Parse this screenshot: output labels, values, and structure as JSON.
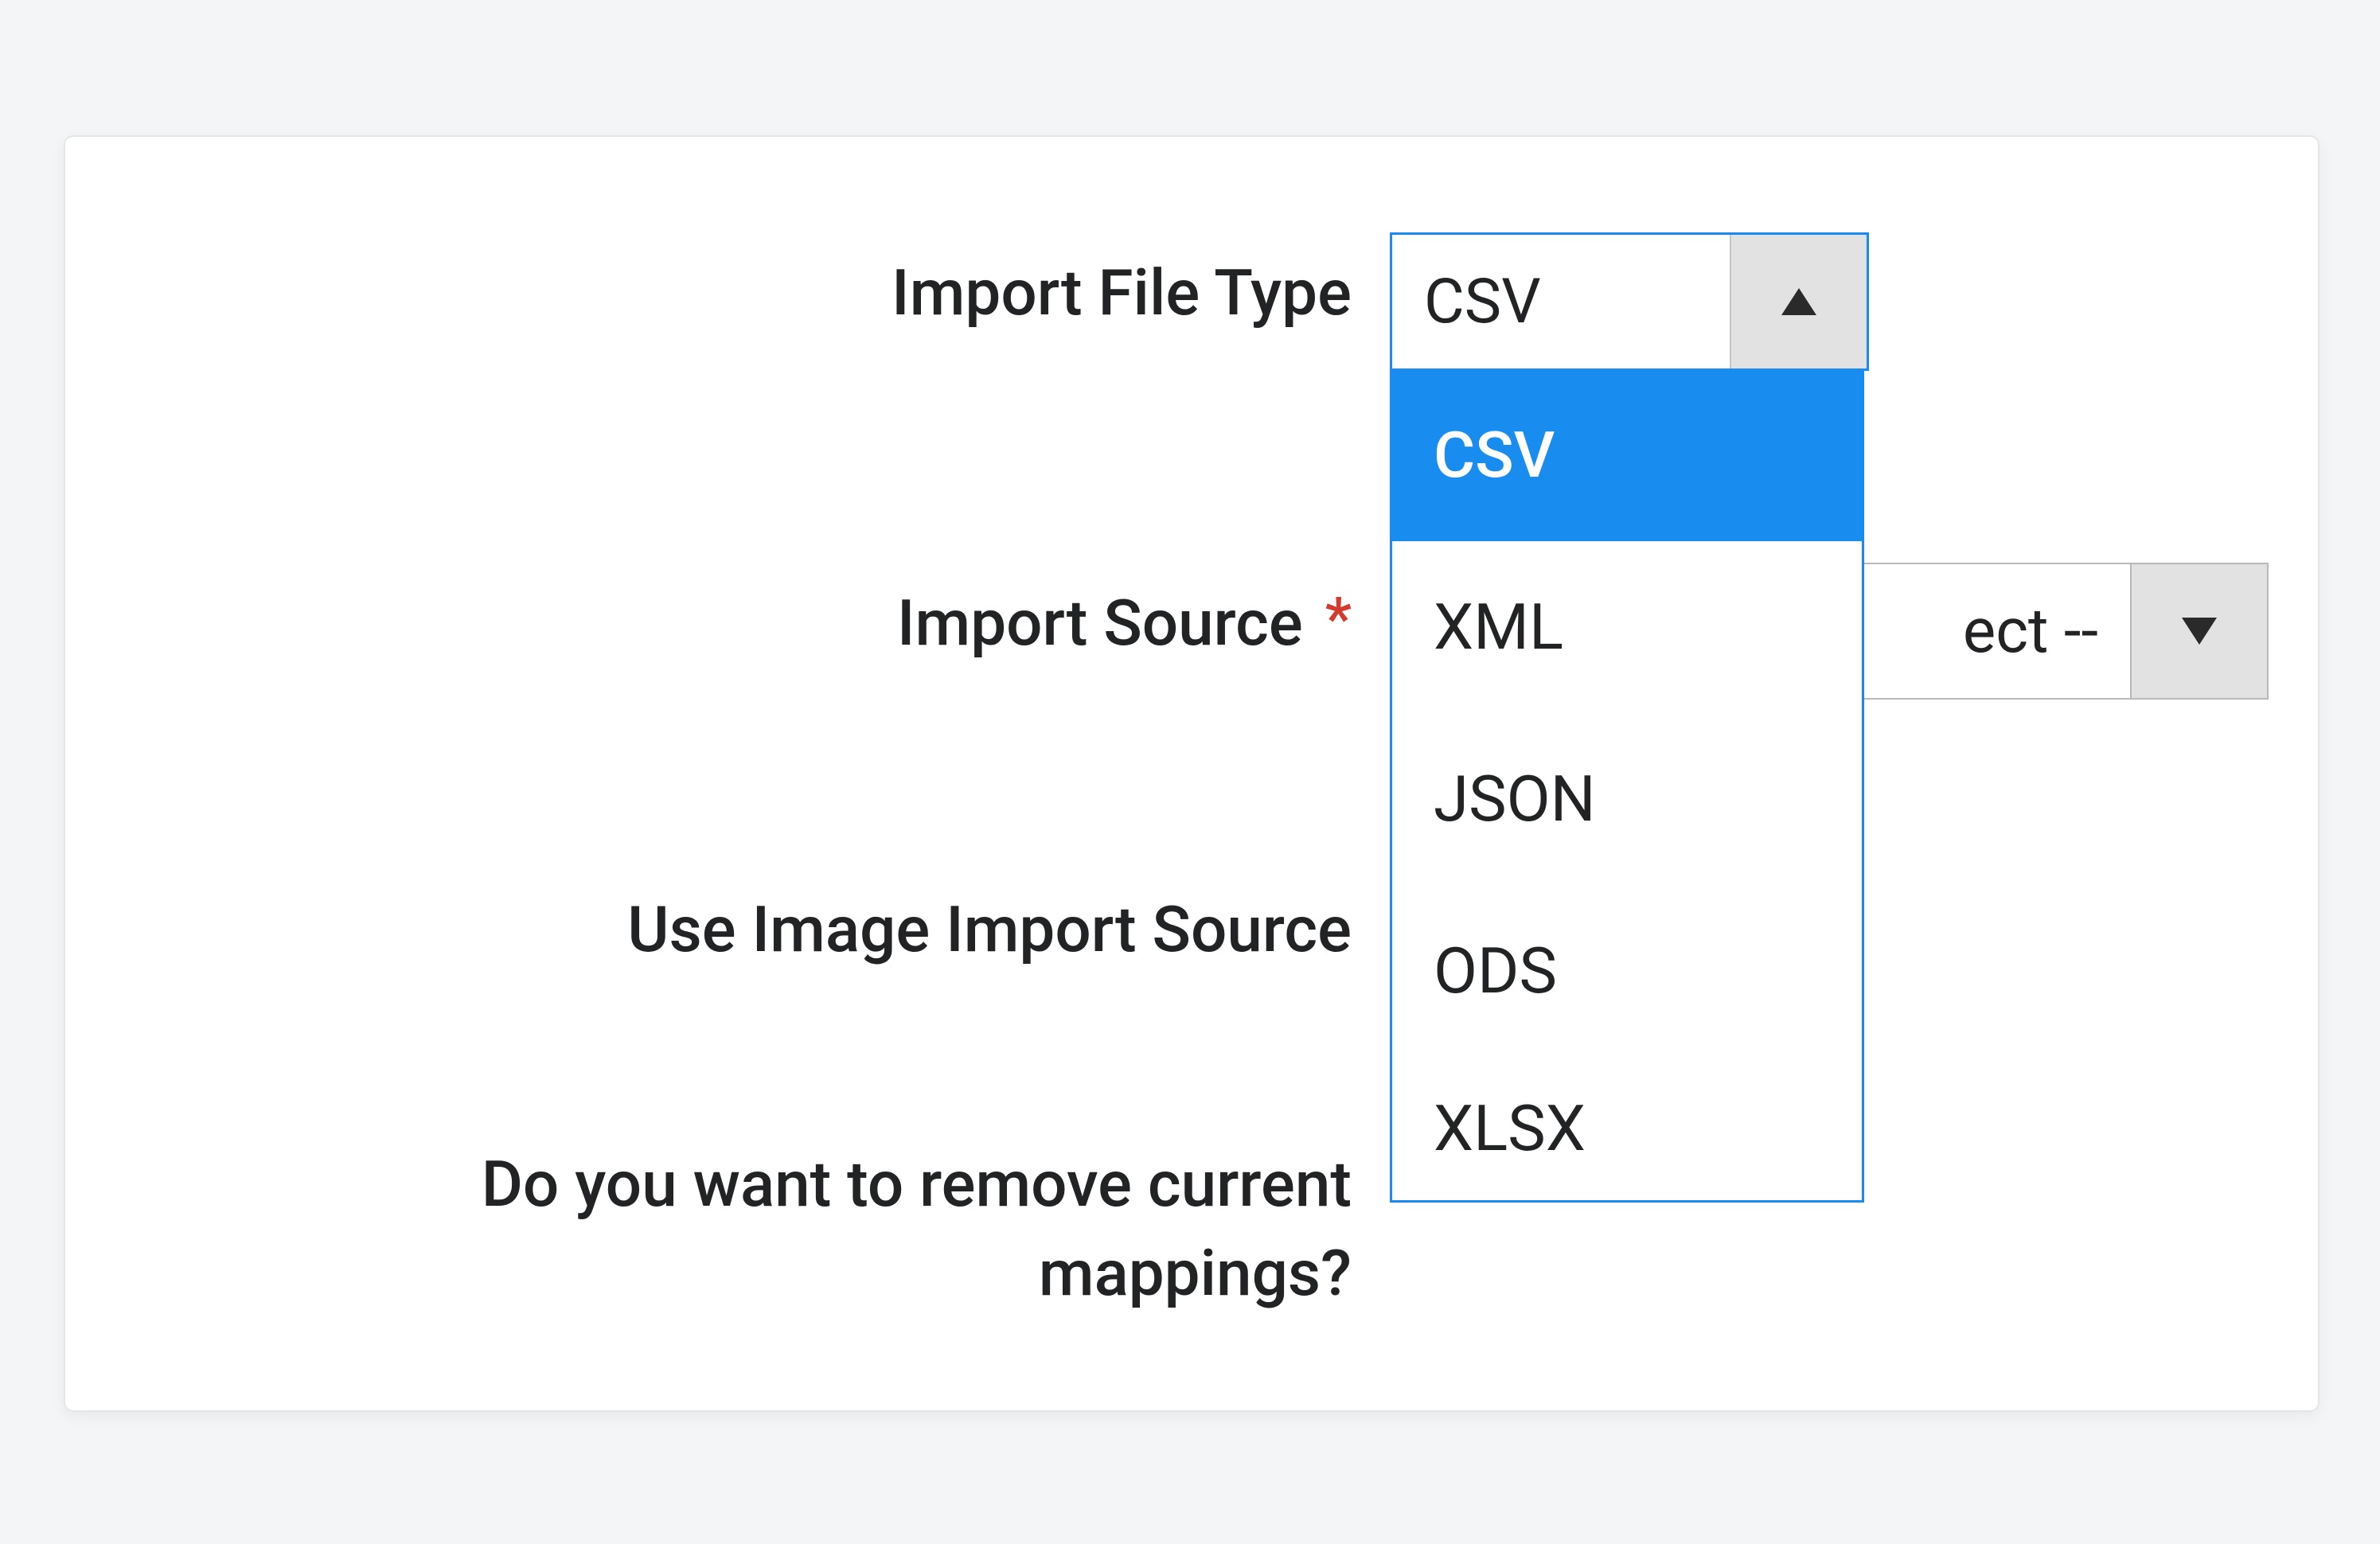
{
  "form": {
    "file_type": {
      "label": "Import File Type",
      "value": "CSV",
      "options": [
        "CSV",
        "XML",
        "JSON",
        "ODS",
        "XLSX"
      ]
    },
    "source": {
      "label": "Import Source",
      "required_mark": "*",
      "value_visible_fragment": "ect --"
    },
    "image_source": {
      "label": "Use Image Import Source"
    },
    "remove_mappings": {
      "label": "Do you want to remove current mappings?"
    }
  }
}
